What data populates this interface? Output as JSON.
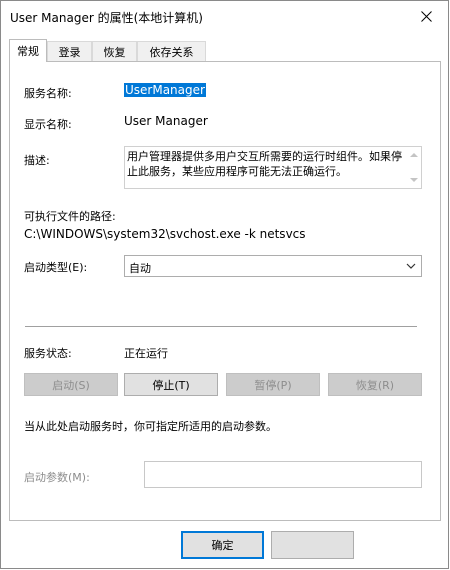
{
  "window": {
    "title": "User Manager 的属性(本地计算机)"
  },
  "tabs": [
    {
      "label": "常规"
    },
    {
      "label": "登录"
    },
    {
      "label": "恢复"
    },
    {
      "label": "依存关系"
    }
  ],
  "general": {
    "service_name_label": "服务名称:",
    "service_name_value": "UserManager",
    "display_name_label": "显示名称:",
    "display_name_value": "User Manager",
    "description_label": "描述:",
    "description_value": "用户管理器提供多用户交互所需要的运行时组件。如果停止此服务，某些应用程序可能无法正确运行。",
    "exe_path_label": "可执行文件的路径:",
    "exe_path_value": "C:\\WINDOWS\\system32\\svchost.exe -k netsvcs",
    "startup_type_label": "启动类型(E):",
    "startup_type_value": "自动",
    "service_status_label": "服务状态:",
    "service_status_value": "正在运行",
    "buttons": {
      "start": "启动(S)",
      "stop": "停止(T)",
      "pause": "暂停(P)",
      "resume": "恢复(R)"
    },
    "hint": "当从此处启动服务时，你可指定所适用的启动参数。",
    "start_params_label": "启动参数(M):",
    "start_params_value": ""
  },
  "footer": {
    "ok": "确定"
  }
}
